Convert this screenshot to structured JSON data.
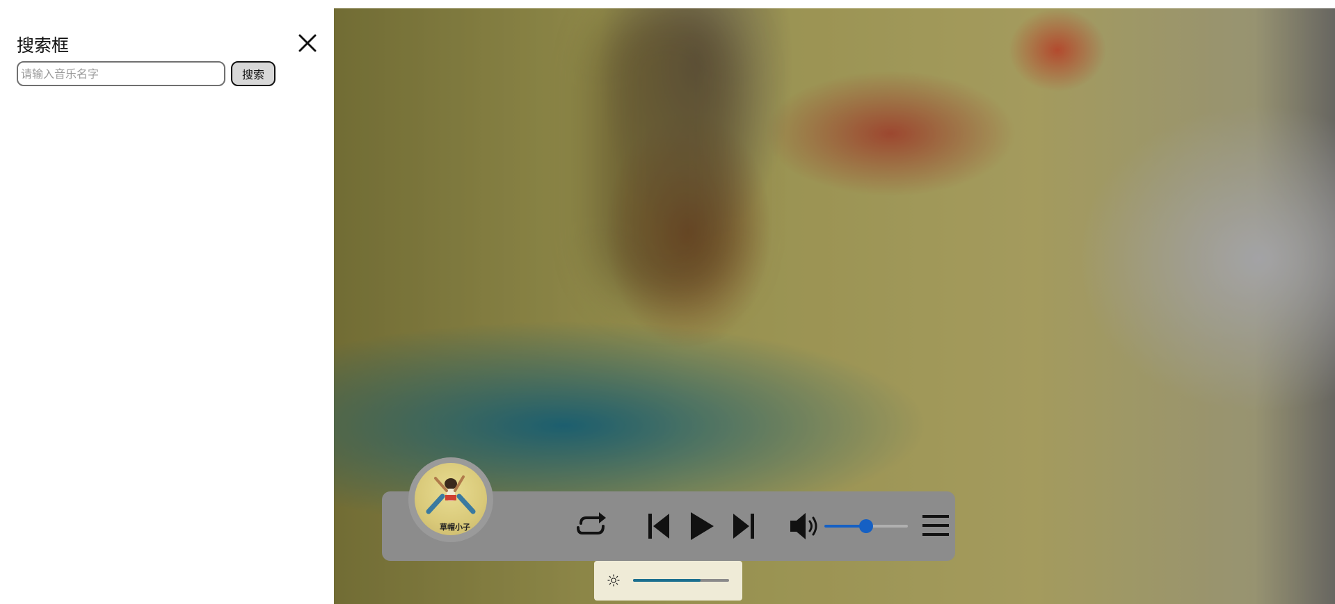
{
  "search_panel": {
    "title": "搜索框",
    "input_placeholder": "请输入音乐名字",
    "input_value": "",
    "search_label": "搜索"
  },
  "player": {
    "album_text": "草帽小子",
    "volume": 0.5,
    "icons": {
      "close": "close-icon",
      "repeat": "repeat-icon",
      "previous": "skip-previous-icon",
      "play": "play-icon",
      "next": "skip-next-icon",
      "volume": "volume-icon",
      "playlist": "menu-icon",
      "brightness": "sun-icon"
    },
    "accent_color": "#1560c4"
  },
  "brightness": {
    "level": 0.7,
    "accent_color": "#1b6f8f"
  }
}
